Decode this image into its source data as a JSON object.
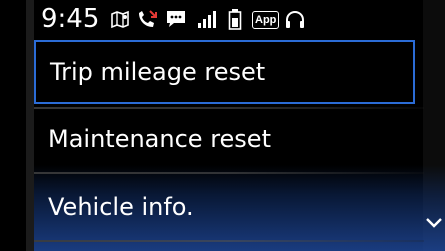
{
  "status_bar": {
    "time": "9:45",
    "icons": [
      "map-book-icon",
      "phone-missed-icon",
      "message-icon",
      "signal-bars-icon",
      "battery-icon",
      "app-icon",
      "headset-icon"
    ],
    "app_badge_label": "App"
  },
  "menu": {
    "items": [
      {
        "label": "Trip mileage reset",
        "selected": true
      },
      {
        "label": "Maintenance reset",
        "selected": false
      },
      {
        "label": "Vehicle info.",
        "selected": false
      }
    ]
  },
  "scroll_hint": {
    "icon": "chevron-down-icon"
  },
  "colors": {
    "background": "#000000",
    "selection_border": "#2b6cd6",
    "text": "#ffffff",
    "phone_icon_red": "#e53935"
  }
}
